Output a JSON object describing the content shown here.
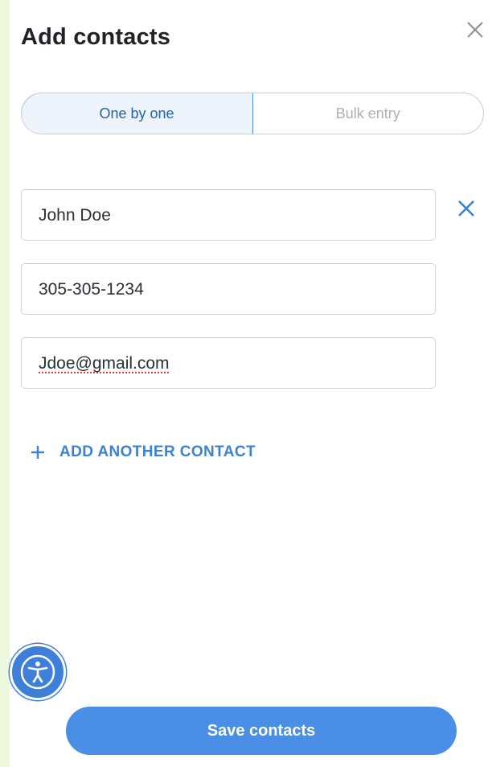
{
  "dialog": {
    "title": "Add contacts",
    "close_icon": "close-icon"
  },
  "mode_toggle": {
    "options": [
      {
        "label": "One by one",
        "selected": true
      },
      {
        "label": "Bulk entry",
        "selected": false
      }
    ]
  },
  "contact_form": {
    "name_value": "John Doe",
    "phone_value": "305-305-1234",
    "email_value": "Jdoe@gmail.com",
    "remove_icon": "close-icon"
  },
  "add_another": {
    "icon": "plus-icon",
    "label": "ADD ANOTHER CONTACT"
  },
  "accessibility_button": {
    "icon": "accessibility-icon"
  },
  "footer": {
    "save_label": "Save contacts"
  },
  "colors": {
    "accent": "#4a8ee6",
    "link": "#3b82d6",
    "page_bg": "#eef8dc",
    "active_tab_bg": "#edf4fc"
  }
}
